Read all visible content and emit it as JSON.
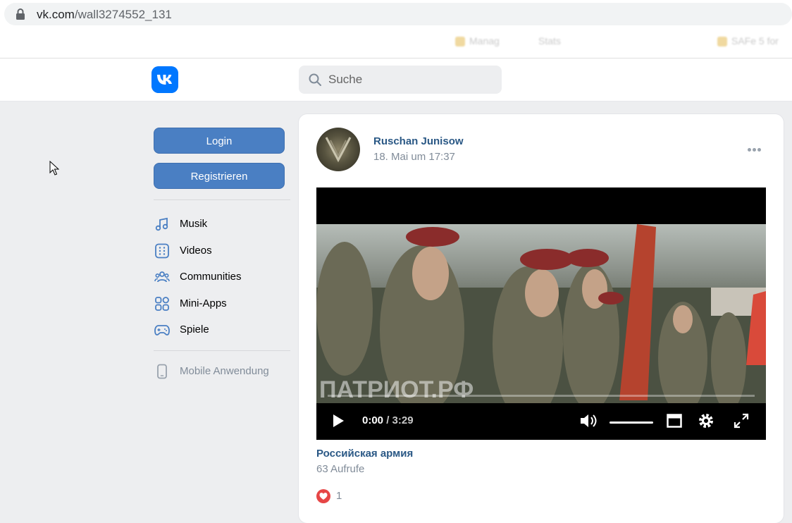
{
  "browser": {
    "url_host": "vk.com",
    "url_path": "/wall3274552_131",
    "bookmarks": [
      "Manag",
      "Stats",
      "SAFe 5 for"
    ]
  },
  "header": {
    "logo": "vk-logo",
    "search_placeholder": "Suche"
  },
  "sidebar": {
    "login_label": "Login",
    "register_label": "Registrieren",
    "items": [
      {
        "label": "Musik",
        "icon": "music-icon"
      },
      {
        "label": "Videos",
        "icon": "videos-icon"
      },
      {
        "label": "Communities",
        "icon": "communities-icon"
      },
      {
        "label": "Mini-Apps",
        "icon": "mini-apps-icon"
      },
      {
        "label": "Spiele",
        "icon": "gamepad-icon"
      }
    ],
    "mobile_label": "Mobile Anwendung"
  },
  "post": {
    "author": "Ruschan Junisow",
    "date": "18. Mai um 17:37",
    "video": {
      "watermark": "ПАТРИОТ.РФ",
      "current_time": "0:00",
      "separator": " / ",
      "duration": "3:29",
      "progress": 0
    },
    "video_title": "Российская армия",
    "views": "63 Aufrufe",
    "likes": "1"
  },
  "colors": {
    "accent": "#0077ff",
    "button": "#4a7fc3",
    "link": "#2a5885",
    "muted": "#818c99",
    "like": "#e64646"
  }
}
